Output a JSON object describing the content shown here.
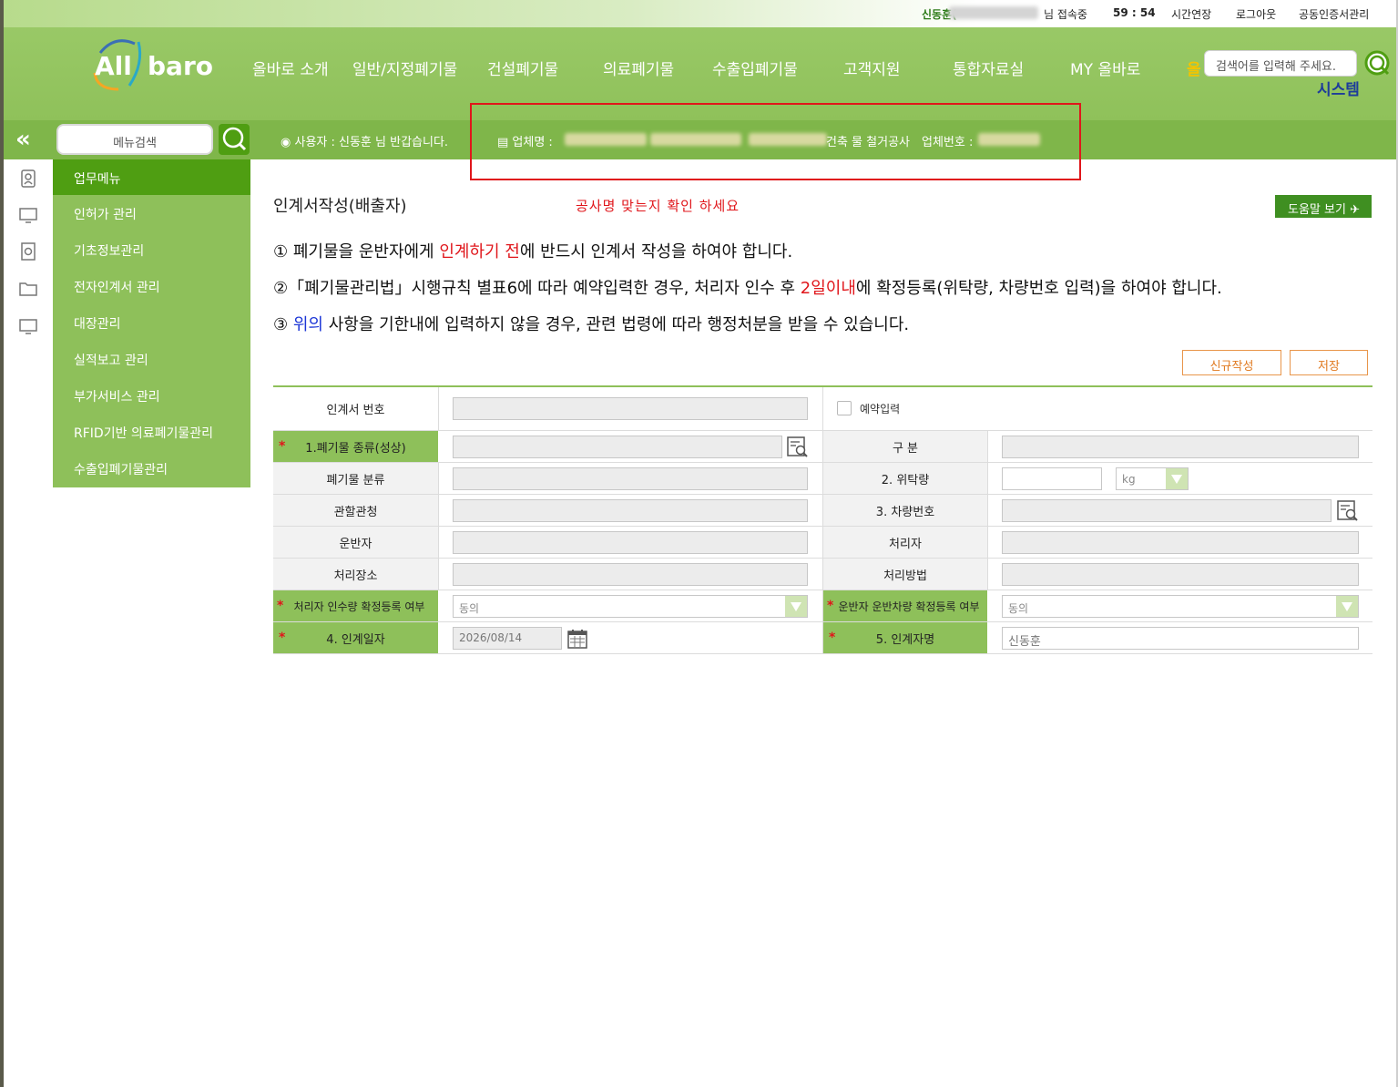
{
  "topbar": {
    "user_name": "신동훈(",
    "user_suffix": "님 접속중",
    "timer": "59 : 54",
    "extend": "시간연장",
    "logout": "로그아웃",
    "cert": "공동인증서관리"
  },
  "logo": {
    "text_left": "All",
    "text_right": "baro"
  },
  "gnb": {
    "items": [
      "올바로 소개",
      "일반/지정폐기물",
      "건설폐기물",
      "의료폐기물",
      "수출입폐기물",
      "고객지원",
      "통합자료실",
      "MY 올바로"
    ],
    "cut_item": "올",
    "system": "시스템"
  },
  "top_search": {
    "placeholder": "검색어를 입력해 주세요."
  },
  "subbar": {
    "menu_search": "메뉴검색",
    "user_greeting": "사용자 : 신동훈 님 반갑습니다.",
    "company_label": "업체명 :",
    "company_tail": "건축 물 철거공사",
    "company_no_label": "업체번호 :"
  },
  "sidemenu": {
    "head": "업무메뉴",
    "items": [
      "인허가 관리",
      "기초정보관리",
      "전자인계서 관리",
      "대장관리",
      "실적보고 관리",
      "부가서비스 관리",
      "RFID기반 의료폐기물관리",
      "수출입폐기물관리"
    ]
  },
  "content": {
    "title": "인계서작성(배출자)",
    "notice": "공사명 맞는지 확인 하세요",
    "help_button": "도움말 보기",
    "rule1_a": "① 폐기물을 운반자에게 ",
    "rule1_red": "인계하기 전",
    "rule1_b": "에 반드시 인계서 작성을 하여야 합니다.",
    "rule2_a": "②「폐기물관리법」시행규칙 별표6에 따라 예약입력한 경우, 처리자 인수 후 ",
    "rule2_red": "2일이내",
    "rule2_b": "에 확정등록(위탁량, 차량번호 입력)을 하여야 합니다.",
    "rule3_a": "③ ",
    "rule3_blue": "위의",
    "rule3_b": " 사항을 기한내에 입력하지 않을 경우, 관련 법령에 따라 행정처분을 받을 수 있습니다.",
    "new_button": "신규작성",
    "save_button": "저장"
  },
  "form": {
    "doc_no_label": "인계서 번호",
    "reserve_label": "예약입력",
    "waste_type_label": "1.폐기물 종류(성상)",
    "division_label": "구 분",
    "waste_class_label": "폐기물 분류",
    "amount_label": "2. 위탁량",
    "unit_value": "kg",
    "authority_label": "관할관청",
    "vehicle_label": "3. 차량번호",
    "carrier_label": "운반자",
    "processor_label": "처리자",
    "place_label": "처리장소",
    "method_label": "처리방법",
    "proc_confirm_label": "처리자 인수량 확정등록 여부",
    "proc_confirm_value": "동의",
    "carrier_confirm_label": "운반자 운반차량 확정등록 여부",
    "carrier_confirm_value": "동의",
    "date_label": "4. 인계일자",
    "date_value": "2026/08/14",
    "person_label": "5. 인계자명",
    "person_value": "신동훈"
  },
  "colors": {
    "header_green": "#8fc15a",
    "menu_head": "#4f9e12",
    "alert_red": "#e0161b",
    "link_blue": "#1b35d6"
  }
}
